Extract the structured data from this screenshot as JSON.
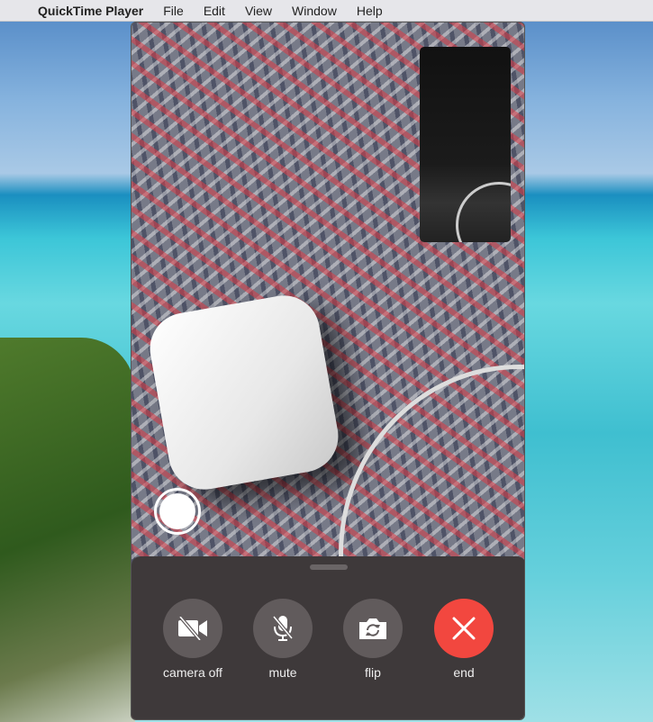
{
  "menubar": {
    "app_name": "QuickTime Player",
    "items": [
      "File",
      "Edit",
      "View",
      "Window",
      "Help"
    ]
  },
  "controls": [
    {
      "label": "camera off",
      "icon": "video-slash-icon"
    },
    {
      "label": "mute",
      "icon": "mic-slash-icon"
    },
    {
      "label": "flip",
      "icon": "camera-flip-icon"
    },
    {
      "label": "end",
      "icon": "close-icon"
    }
  ],
  "colors": {
    "end": "#f2473f",
    "panel": "#3e393a",
    "button": "#615b5c"
  }
}
